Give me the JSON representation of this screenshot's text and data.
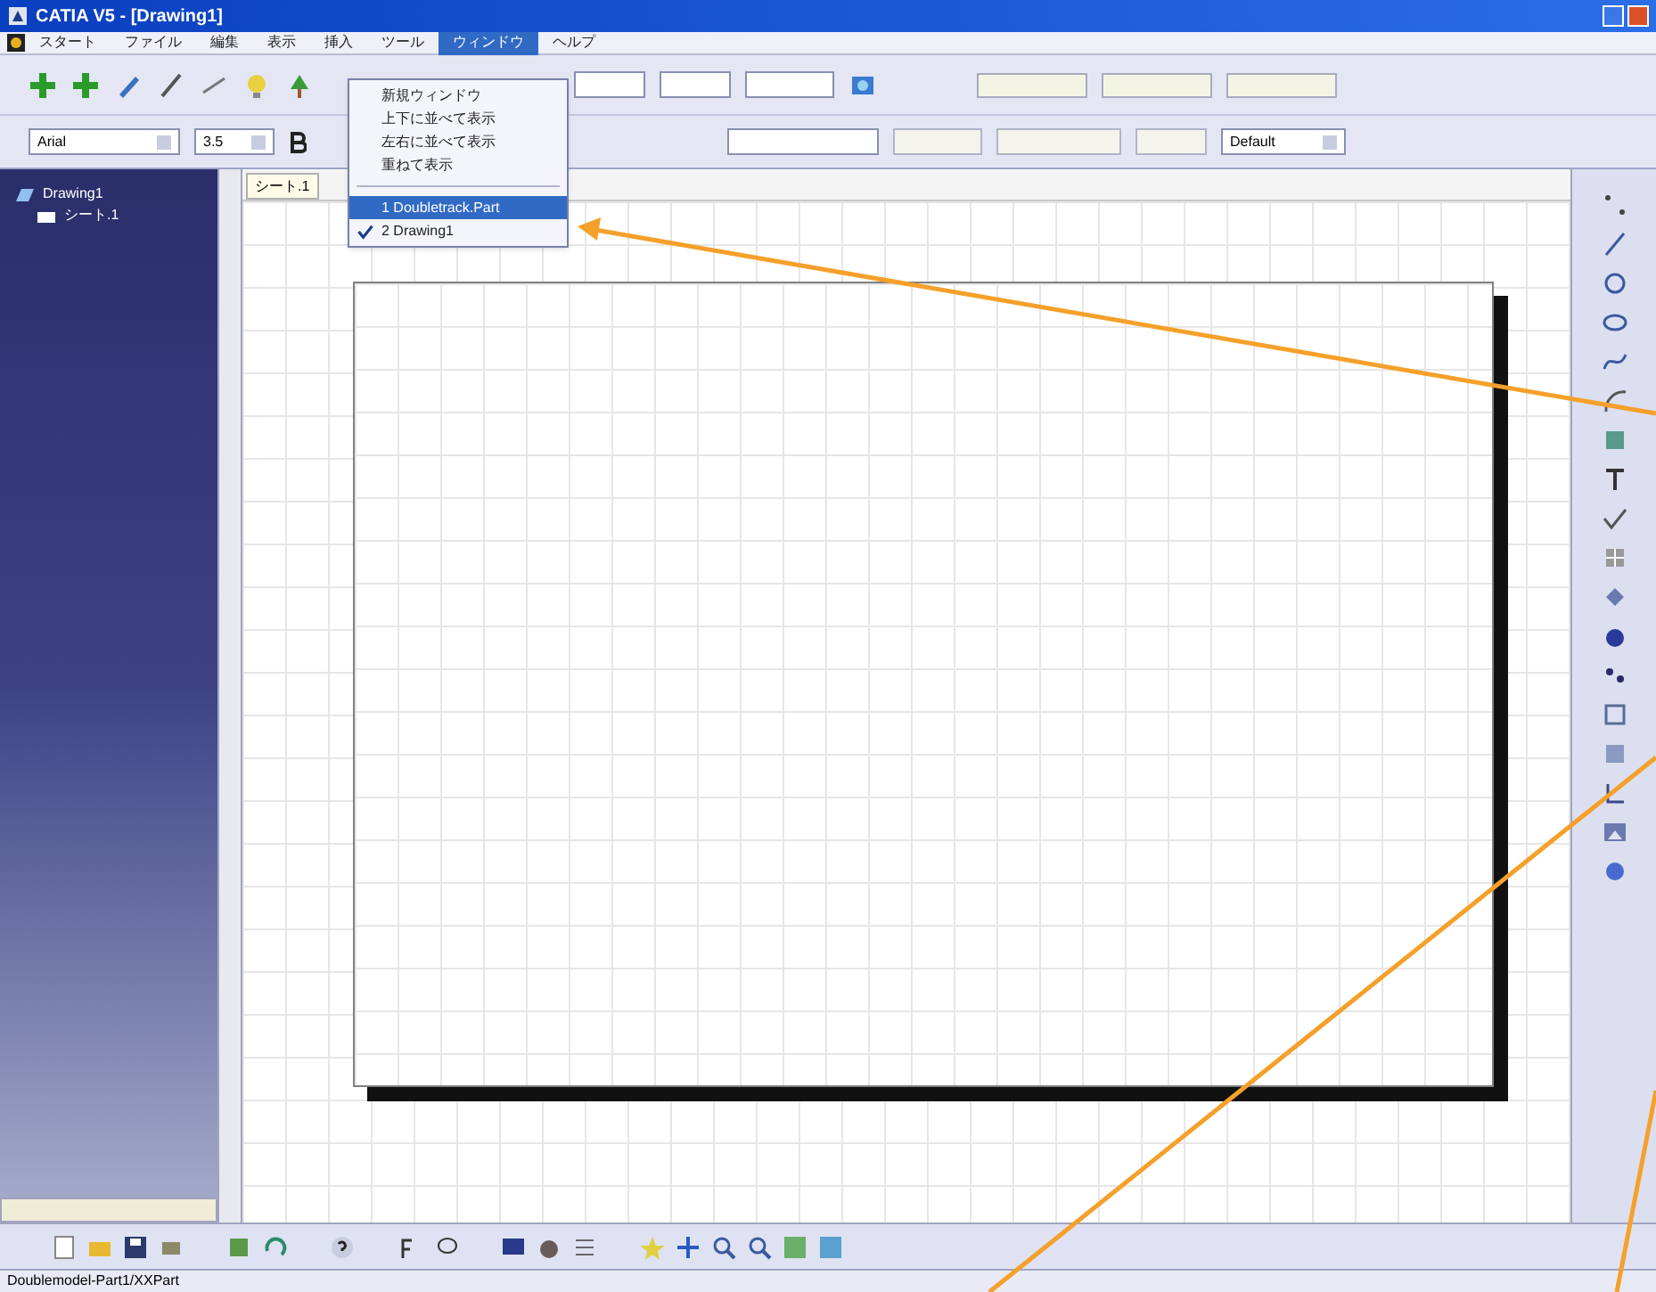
{
  "window": {
    "title": "CATIA V5 - [Drawing1]"
  },
  "menu": [
    {
      "label": "スタート",
      "selected": false
    },
    {
      "label": "ファイル",
      "selected": false
    },
    {
      "label": "編集",
      "selected": false
    },
    {
      "label": "表示",
      "selected": false
    },
    {
      "label": "挿入",
      "selected": false
    },
    {
      "label": "ツール",
      "selected": false
    },
    {
      "label": "ウィンドウ",
      "selected": true
    },
    {
      "label": "ヘルプ",
      "selected": false
    }
  ],
  "window_menu": {
    "items": [
      {
        "label": "新規ウィンドウ",
        "checked": false,
        "selected": false
      },
      {
        "label": "上下に並べて表示",
        "checked": false,
        "selected": false
      },
      {
        "label": "左右に並べて表示",
        "checked": false,
        "selected": false
      },
      {
        "label": "重ねて表示",
        "checked": false,
        "selected": false
      },
      {
        "label": "1 Doubletrack.Part",
        "checked": false,
        "selected": true
      },
      {
        "label": "2 Drawing1",
        "checked": true,
        "selected": false
      }
    ]
  },
  "text_toolbar": {
    "font": "Arial",
    "size": "3.5",
    "style": "Default"
  },
  "tree": [
    {
      "label": "Drawing1",
      "children": [
        {
          "label": "シート.1"
        }
      ]
    }
  ],
  "sheet_tab": {
    "label": "シート.1"
  },
  "status_bar": {
    "text": "Doublemodel-Part1/XXPart"
  }
}
